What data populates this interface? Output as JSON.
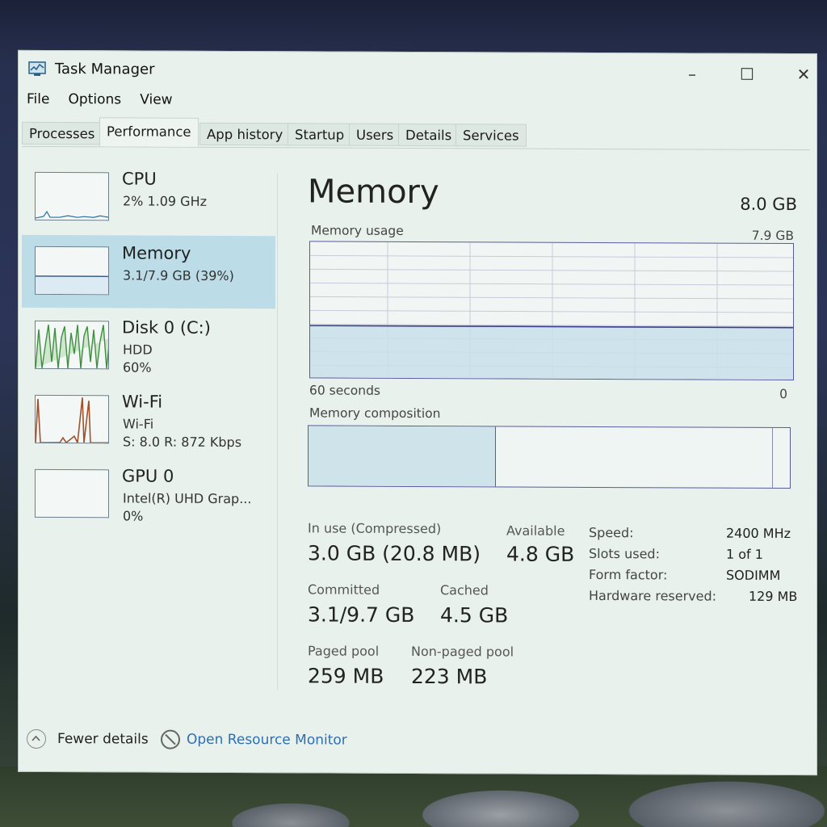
{
  "window": {
    "title": "Task Manager",
    "minimize": "–",
    "maximize": "☐",
    "close": "✕"
  },
  "menu": [
    "File",
    "Options",
    "View"
  ],
  "tabs": [
    "Processes",
    "Performance",
    "App history",
    "Startup",
    "Users",
    "Details",
    "Services"
  ],
  "active_tab": "Performance",
  "sidebar": {
    "items": [
      {
        "title": "CPU",
        "sub1": "2% 1.09 GHz",
        "sub2": ""
      },
      {
        "title": "Memory",
        "sub1": "3.1/7.9 GB (39%)",
        "sub2": ""
      },
      {
        "title": "Disk 0 (C:)",
        "sub1": "HDD",
        "sub2": "60%"
      },
      {
        "title": "Wi-Fi",
        "sub1": "Wi-Fi",
        "sub2": "S: 8.0 R: 872 Kbps"
      },
      {
        "title": "GPU 0",
        "sub1": "Intel(R) UHD Grap...",
        "sub2": "0%"
      }
    ],
    "selected": "Memory"
  },
  "memory": {
    "title": "Memory",
    "total": "8.0 GB",
    "usage_label": "Memory usage",
    "usage_max": "7.9 GB",
    "time_span": "60 seconds",
    "time_end": "0",
    "composition_label": "Memory composition",
    "usage_level": 0.39,
    "composition": {
      "in_use_fraction": 0.39,
      "modified_fraction": 0.004,
      "standby_fraction": 0.57
    },
    "stats": {
      "in_use_label": "In use (Compressed)",
      "in_use": "3.0 GB (20.8 MB)",
      "available_label": "Available",
      "available": "4.8 GB",
      "committed_label": "Committed",
      "committed": "3.1/9.7 GB",
      "cached_label": "Cached",
      "cached": "4.5 GB",
      "paged_label": "Paged pool",
      "paged": "259 MB",
      "nonpaged_label": "Non-paged pool",
      "nonpaged": "223 MB"
    },
    "specs": {
      "speed_label": "Speed:",
      "speed": "2400 MHz",
      "slots_label": "Slots used:",
      "slots": "1 of 1",
      "form_label": "Form factor:",
      "form": "SODIMM",
      "hwres_label": "Hardware reserved:",
      "hwres": "129 MB"
    }
  },
  "footer": {
    "fewer_details": "Fewer details",
    "open_monitor": "Open Resource Monitor"
  },
  "colors": {
    "accent_selected": "#bcdde8",
    "graph_border": "#5a5a9e",
    "link": "#2f6fb0",
    "disk_line": "#3f8f3f",
    "wifi_line": "#a0522d"
  }
}
